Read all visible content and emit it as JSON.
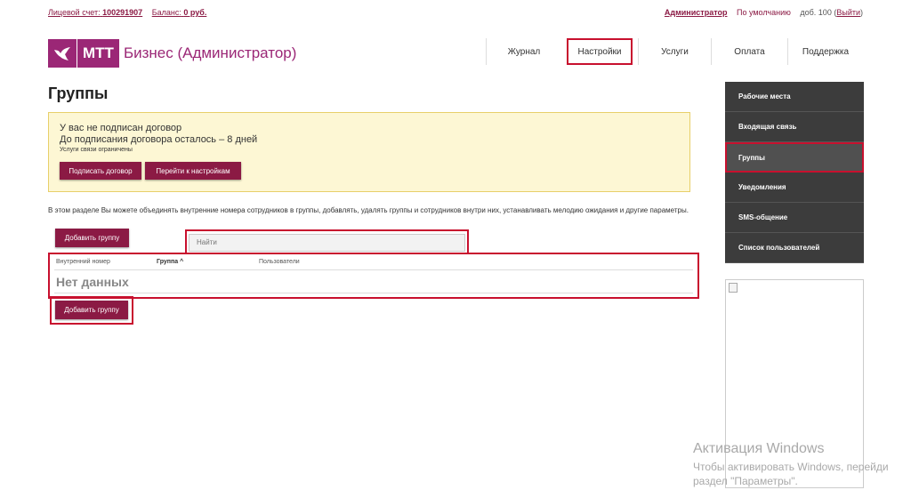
{
  "top_bar": {
    "account_label": "Лицевой счет:",
    "account_number": "100291907",
    "balance_label": "Баланс:",
    "balance_value": "0 руб.",
    "admin": "Администратор",
    "profile": "По умолчанию",
    "extension": "доб. 100",
    "logout_open": "(",
    "logout": "Выйти",
    "logout_close": ")"
  },
  "logo": {
    "mark_icon": "bird-icon",
    "brand": "МТТ",
    "product": "Бизнес (Администратор)"
  },
  "nav": {
    "items": [
      {
        "label": "Журнал"
      },
      {
        "label": "Настройки",
        "active": true
      },
      {
        "label": "Услуги"
      },
      {
        "label": "Оплата"
      },
      {
        "label": "Поддержка"
      }
    ]
  },
  "page": {
    "title": "Группы"
  },
  "notice": {
    "line1": "У вас не подписан договор",
    "line2": "До подписания договора осталось – 8 дней",
    "line3": "Услуги связи ограничены",
    "sign_button": "Подписать договор",
    "settings_button": "Перейти к настройкам"
  },
  "description": "В этом разделе Вы можете объединять внутренние номера сотрудников в группы, добавлять, удалять группы и сотрудников внутри них, устанавливать мелодию ожидания и другие параметры.",
  "actions": {
    "add_group": "Добавить группу"
  },
  "search": {
    "placeholder": "Найти"
  },
  "table": {
    "columns": [
      "Внутренний номер",
      "Группа ^",
      "Пользователи"
    ],
    "empty": "Нет данных"
  },
  "sidebar": {
    "items": [
      {
        "label": "Рабочие места"
      },
      {
        "label": "Входящая связь"
      },
      {
        "label": "Группы",
        "active": true
      },
      {
        "label": "Уведомления"
      },
      {
        "label": "SMS-общение"
      },
      {
        "label": "Список пользователей"
      }
    ]
  },
  "windows_watermark": {
    "title": "Активация Windows",
    "line1": "Чтобы активировать Windows, перейди",
    "line2": "раздел \"Параметры\"."
  },
  "colors": {
    "brand": "#9b2776",
    "button": "#8b1a44",
    "highlight": "#c8102e",
    "sidebar": "#3c3c3c",
    "notice_bg": "#fdf7d4"
  }
}
